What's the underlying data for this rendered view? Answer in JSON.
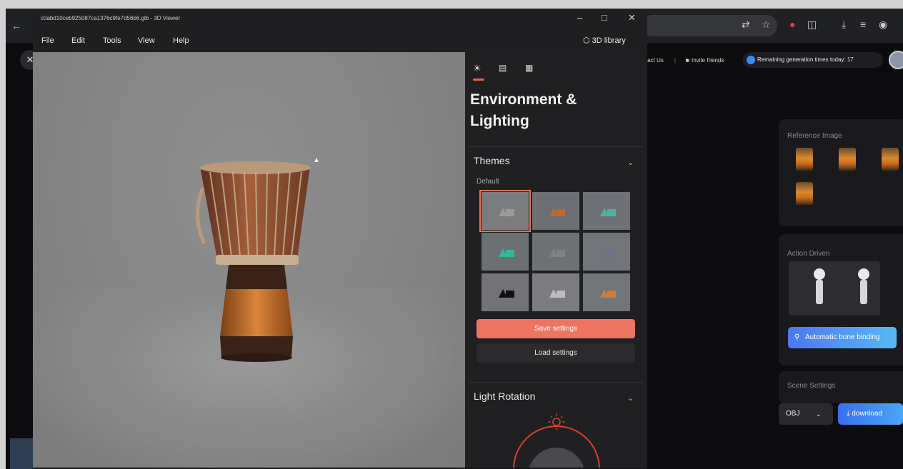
{
  "browser": {
    "back_icon": "arrow-left-icon",
    "header_links": [
      "tact Us",
      "|",
      "Invite friends"
    ],
    "remaining": "Remaining generation times today: 17",
    "reference_title": "Reference Image",
    "action_title": "Action Driven",
    "bone_button": "Automatic bone binding",
    "scene_title": "Scene Settings",
    "format_value": "OBJ",
    "download_label": "download"
  },
  "viewer": {
    "window_title": "c0abd10ceb925087ca1376c9fe7d56b6.glb - 3D Viewer",
    "window_controls": {
      "minimize": "–",
      "maximize": "□",
      "close": "✕"
    },
    "menu": [
      "File",
      "Edit",
      "Tools",
      "View",
      "Help"
    ],
    "library_label": "3D library"
  },
  "panel": {
    "title": "Environment & Lighting",
    "themes_label": "Themes",
    "default_label": "Default",
    "save_label": "Save settings",
    "load_label": "Load settings",
    "light_rotation_label": "Light Rotation",
    "theme_tiles": [
      {
        "bg": "#7a7c7e",
        "shape": "#9a9a9a"
      },
      {
        "bg": "#6c6f73",
        "shape": "#c4662a"
      },
      {
        "bg": "#6e7276",
        "shape": "#4ab3a3"
      },
      {
        "bg": "#6c7073",
        "shape": "#2fb89a"
      },
      {
        "bg": "#6f7275",
        "shape": "#7d8286"
      },
      {
        "bg": "#717478",
        "shape": "#6e7088"
      },
      {
        "bg": "#717377",
        "shape": "#111111"
      },
      {
        "bg": "#7a7c7f",
        "shape": "#bdbdbd"
      },
      {
        "bg": "#717478",
        "shape": "#d27a3a"
      }
    ]
  },
  "colors": {
    "accent": "#ee7462",
    "panel_bg": "#202022",
    "viewport_bg": "#878787",
    "blue_button": "#4c77f0"
  }
}
